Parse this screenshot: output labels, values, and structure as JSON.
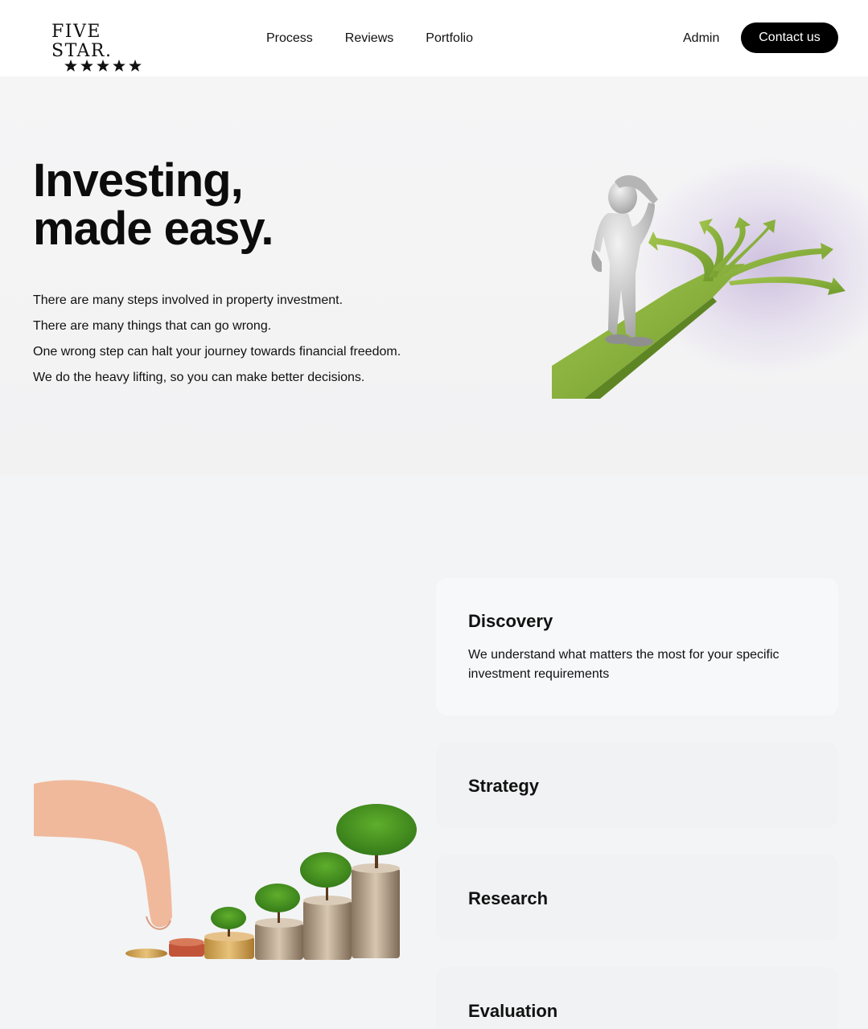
{
  "brand": {
    "name": "FIVE STAR.",
    "stars": 5
  },
  "nav": {
    "items": [
      {
        "label": "Process"
      },
      {
        "label": "Reviews"
      },
      {
        "label": "Portfolio"
      }
    ],
    "admin_label": "Admin",
    "contact_label": "Contact us"
  },
  "hero": {
    "title_line1": "Investing,",
    "title_line2": "made easy.",
    "lines": [
      "There are many steps involved in property investment.",
      "There are many things that can go wrong.",
      "One wrong step can halt your journey towards financial freedom.",
      "We do the heavy lifting, so you can make better decisions."
    ]
  },
  "process": {
    "steps": [
      {
        "title": "Discovery",
        "description": "We understand what matters the most for your specific investment requirements",
        "expanded": true
      },
      {
        "title": "Strategy",
        "description": "",
        "expanded": false
      },
      {
        "title": "Research",
        "description": "",
        "expanded": false
      },
      {
        "title": "Evaluation",
        "description": "",
        "expanded": false
      }
    ]
  },
  "colors": {
    "accent": "#000000",
    "path_green": "#8ab43a",
    "page_bg": "#f3f4f5"
  }
}
